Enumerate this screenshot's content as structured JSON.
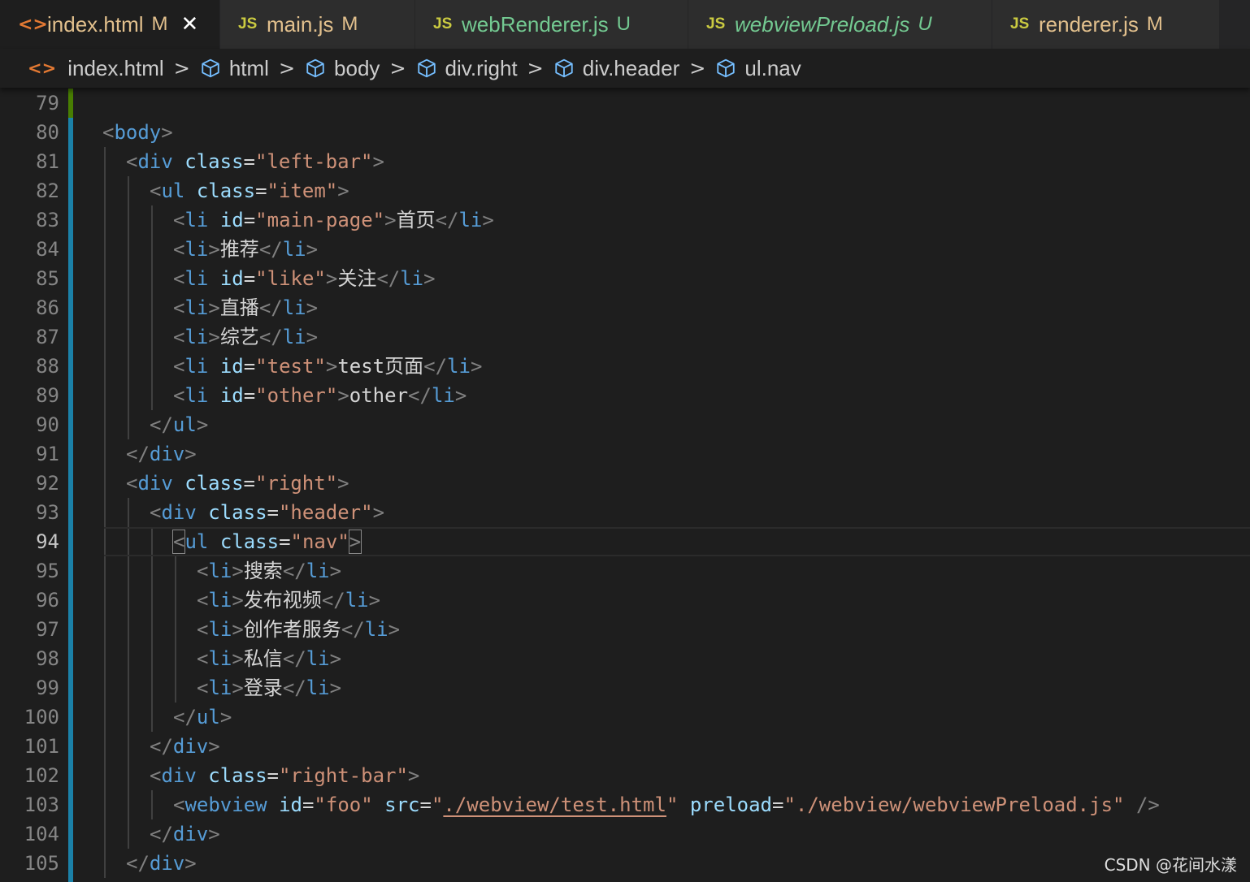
{
  "tabs": [
    {
      "icon": "html-icon",
      "glyph": "<>",
      "name": "index.html",
      "status": "M",
      "name_color": "#e2c08d",
      "status_color": "#e2c08d",
      "active": true,
      "close": "✕",
      "italic": false,
      "width": 271
    },
    {
      "icon": "js-icon",
      "glyph": "JS",
      "name": "main.js",
      "status": "M",
      "name_color": "#e2c08d",
      "status_color": "#e2c08d",
      "active": false,
      "italic": false,
      "width": 240
    },
    {
      "icon": "js-icon",
      "glyph": "JS",
      "name": "webRenderer.js",
      "status": "U",
      "name_color": "#73c991",
      "status_color": "#73c991",
      "active": false,
      "italic": false,
      "width": 336
    },
    {
      "icon": "js-icon",
      "glyph": "JS",
      "name": "webviewPreload.js",
      "status": "U",
      "name_color": "#73c991",
      "status_color": "#73c991",
      "active": false,
      "italic": true,
      "width": 374
    },
    {
      "icon": "js-icon",
      "glyph": "JS",
      "name": "renderer.js",
      "status": "M",
      "name_color": "#e2c08d",
      "status_color": "#e2c08d",
      "active": false,
      "italic": false,
      "width": 280
    }
  ],
  "breadcrumb": [
    {
      "icon": "html-icon",
      "label": "index.html"
    },
    {
      "icon": "cube-icon",
      "label": "html"
    },
    {
      "icon": "cube-icon",
      "label": "body"
    },
    {
      "icon": "cube-icon",
      "label": "div.right"
    },
    {
      "icon": "cube-icon",
      "label": "div.header"
    },
    {
      "icon": "cube-icon",
      "label": "ul.nav"
    }
  ],
  "separator": ">",
  "colors": {
    "background": "#1e1e1e",
    "tag": "#569cd6",
    "attribute": "#9cdcfe",
    "string": "#ce9178",
    "bracket": "#808080",
    "text": "#d4d4d4",
    "gutter_modified": "#1b81a8",
    "gutter_added": "#487e02"
  },
  "current_line": 94,
  "lines": [
    {
      "n": 79,
      "indent": 0,
      "tokens": []
    },
    {
      "n": 80,
      "indent": 0,
      "tokens": [
        [
          "b",
          "<"
        ],
        [
          "tag",
          "body"
        ],
        [
          "b",
          ">"
        ]
      ]
    },
    {
      "n": 81,
      "indent": 1,
      "tokens": [
        [
          "b",
          "<"
        ],
        [
          "tag",
          "div"
        ],
        [
          "txt",
          " "
        ],
        [
          "attr",
          "class"
        ],
        [
          "txt",
          "="
        ],
        [
          "str",
          "\"left-bar\""
        ],
        [
          "b",
          ">"
        ]
      ]
    },
    {
      "n": 82,
      "indent": 2,
      "tokens": [
        [
          "b",
          "<"
        ],
        [
          "tag",
          "ul"
        ],
        [
          "txt",
          " "
        ],
        [
          "attr",
          "class"
        ],
        [
          "txt",
          "="
        ],
        [
          "str",
          "\"item\""
        ],
        [
          "b",
          ">"
        ]
      ]
    },
    {
      "n": 83,
      "indent": 3,
      "tokens": [
        [
          "b",
          "<"
        ],
        [
          "tag",
          "li"
        ],
        [
          "txt",
          " "
        ],
        [
          "attr",
          "id"
        ],
        [
          "txt",
          "="
        ],
        [
          "str",
          "\"main-page\""
        ],
        [
          "b",
          ">"
        ],
        [
          "txt",
          "首页"
        ],
        [
          "b",
          "</"
        ],
        [
          "tag",
          "li"
        ],
        [
          "b",
          ">"
        ]
      ]
    },
    {
      "n": 84,
      "indent": 3,
      "tokens": [
        [
          "b",
          "<"
        ],
        [
          "tag",
          "li"
        ],
        [
          "b",
          ">"
        ],
        [
          "txt",
          "推荐"
        ],
        [
          "b",
          "</"
        ],
        [
          "tag",
          "li"
        ],
        [
          "b",
          ">"
        ]
      ]
    },
    {
      "n": 85,
      "indent": 3,
      "tokens": [
        [
          "b",
          "<"
        ],
        [
          "tag",
          "li"
        ],
        [
          "txt",
          " "
        ],
        [
          "attr",
          "id"
        ],
        [
          "txt",
          "="
        ],
        [
          "str",
          "\"like\""
        ],
        [
          "b",
          ">"
        ],
        [
          "txt",
          "关注"
        ],
        [
          "b",
          "</"
        ],
        [
          "tag",
          "li"
        ],
        [
          "b",
          ">"
        ]
      ]
    },
    {
      "n": 86,
      "indent": 3,
      "tokens": [
        [
          "b",
          "<"
        ],
        [
          "tag",
          "li"
        ],
        [
          "b",
          ">"
        ],
        [
          "txt",
          "直播"
        ],
        [
          "b",
          "</"
        ],
        [
          "tag",
          "li"
        ],
        [
          "b",
          ">"
        ]
      ]
    },
    {
      "n": 87,
      "indent": 3,
      "tokens": [
        [
          "b",
          "<"
        ],
        [
          "tag",
          "li"
        ],
        [
          "b",
          ">"
        ],
        [
          "txt",
          "综艺"
        ],
        [
          "b",
          "</"
        ],
        [
          "tag",
          "li"
        ],
        [
          "b",
          ">"
        ]
      ]
    },
    {
      "n": 88,
      "indent": 3,
      "tokens": [
        [
          "b",
          "<"
        ],
        [
          "tag",
          "li"
        ],
        [
          "txt",
          " "
        ],
        [
          "attr",
          "id"
        ],
        [
          "txt",
          "="
        ],
        [
          "str",
          "\"test\""
        ],
        [
          "b",
          ">"
        ],
        [
          "txt",
          "test页面"
        ],
        [
          "b",
          "</"
        ],
        [
          "tag",
          "li"
        ],
        [
          "b",
          ">"
        ]
      ]
    },
    {
      "n": 89,
      "indent": 3,
      "tokens": [
        [
          "b",
          "<"
        ],
        [
          "tag",
          "li"
        ],
        [
          "txt",
          " "
        ],
        [
          "attr",
          "id"
        ],
        [
          "txt",
          "="
        ],
        [
          "str",
          "\"other\""
        ],
        [
          "b",
          ">"
        ],
        [
          "txt",
          "other"
        ],
        [
          "b",
          "</"
        ],
        [
          "tag",
          "li"
        ],
        [
          "b",
          ">"
        ]
      ]
    },
    {
      "n": 90,
      "indent": 2,
      "tokens": [
        [
          "b",
          "</"
        ],
        [
          "tag",
          "ul"
        ],
        [
          "b",
          ">"
        ]
      ]
    },
    {
      "n": 91,
      "indent": 1,
      "tokens": [
        [
          "b",
          "</"
        ],
        [
          "tag",
          "div"
        ],
        [
          "b",
          ">"
        ]
      ]
    },
    {
      "n": 92,
      "indent": 1,
      "tokens": [
        [
          "b",
          "<"
        ],
        [
          "tag",
          "div"
        ],
        [
          "txt",
          " "
        ],
        [
          "attr",
          "class"
        ],
        [
          "txt",
          "="
        ],
        [
          "str",
          "\"right\""
        ],
        [
          "b",
          ">"
        ]
      ]
    },
    {
      "n": 93,
      "indent": 2,
      "tokens": [
        [
          "b",
          "<"
        ],
        [
          "tag",
          "div"
        ],
        [
          "txt",
          " "
        ],
        [
          "attr",
          "class"
        ],
        [
          "txt",
          "="
        ],
        [
          "str",
          "\"header\""
        ],
        [
          "b",
          ">"
        ]
      ]
    },
    {
      "n": 94,
      "indent": 3,
      "tokens": [
        [
          "bm",
          "<"
        ],
        [
          "tag",
          "ul"
        ],
        [
          "txt",
          " "
        ],
        [
          "attr",
          "class"
        ],
        [
          "txt",
          "="
        ],
        [
          "str",
          "\"nav\""
        ],
        [
          "bm",
          ">"
        ]
      ]
    },
    {
      "n": 95,
      "indent": 4,
      "tokens": [
        [
          "b",
          "<"
        ],
        [
          "tag",
          "li"
        ],
        [
          "b",
          ">"
        ],
        [
          "txt",
          "搜索"
        ],
        [
          "b",
          "</"
        ],
        [
          "tag",
          "li"
        ],
        [
          "b",
          ">"
        ]
      ]
    },
    {
      "n": 96,
      "indent": 4,
      "tokens": [
        [
          "b",
          "<"
        ],
        [
          "tag",
          "li"
        ],
        [
          "b",
          ">"
        ],
        [
          "txt",
          "发布视频"
        ],
        [
          "b",
          "</"
        ],
        [
          "tag",
          "li"
        ],
        [
          "b",
          ">"
        ]
      ]
    },
    {
      "n": 97,
      "indent": 4,
      "tokens": [
        [
          "b",
          "<"
        ],
        [
          "tag",
          "li"
        ],
        [
          "b",
          ">"
        ],
        [
          "txt",
          "创作者服务"
        ],
        [
          "b",
          "</"
        ],
        [
          "tag",
          "li"
        ],
        [
          "b",
          ">"
        ]
      ]
    },
    {
      "n": 98,
      "indent": 4,
      "tokens": [
        [
          "b",
          "<"
        ],
        [
          "tag",
          "li"
        ],
        [
          "b",
          ">"
        ],
        [
          "txt",
          "私信"
        ],
        [
          "b",
          "</"
        ],
        [
          "tag",
          "li"
        ],
        [
          "b",
          ">"
        ]
      ]
    },
    {
      "n": 99,
      "indent": 4,
      "tokens": [
        [
          "b",
          "<"
        ],
        [
          "tag",
          "li"
        ],
        [
          "b",
          ">"
        ],
        [
          "txt",
          "登录"
        ],
        [
          "b",
          "</"
        ],
        [
          "tag",
          "li"
        ],
        [
          "b",
          ">"
        ]
      ]
    },
    {
      "n": 100,
      "indent": 3,
      "tokens": [
        [
          "b",
          "</"
        ],
        [
          "tag",
          "ul"
        ],
        [
          "b",
          ">"
        ]
      ]
    },
    {
      "n": 101,
      "indent": 2,
      "tokens": [
        [
          "b",
          "</"
        ],
        [
          "tag",
          "div"
        ],
        [
          "b",
          ">"
        ]
      ]
    },
    {
      "n": 102,
      "indent": 2,
      "tokens": [
        [
          "b",
          "<"
        ],
        [
          "tag",
          "div"
        ],
        [
          "txt",
          " "
        ],
        [
          "attr",
          "class"
        ],
        [
          "txt",
          "="
        ],
        [
          "str",
          "\"right-bar\""
        ],
        [
          "b",
          ">"
        ]
      ]
    },
    {
      "n": 103,
      "indent": 3,
      "tokens": [
        [
          "b",
          "<"
        ],
        [
          "tag",
          "webview"
        ],
        [
          "txt",
          " "
        ],
        [
          "attr",
          "id"
        ],
        [
          "txt",
          "="
        ],
        [
          "str",
          "\"foo\""
        ],
        [
          "txt",
          " "
        ],
        [
          "attr",
          "src"
        ],
        [
          "txt",
          "="
        ],
        [
          "str",
          "\""
        ],
        [
          "link",
          "./webview/test.html"
        ],
        [
          "str",
          "\""
        ],
        [
          "txt",
          " "
        ],
        [
          "attr",
          "preload"
        ],
        [
          "txt",
          "="
        ],
        [
          "str",
          "\"./webview/webviewPreload.js\""
        ],
        [
          "txt",
          " "
        ],
        [
          "b",
          "/>"
        ]
      ]
    },
    {
      "n": 104,
      "indent": 2,
      "tokens": [
        [
          "b",
          "</"
        ],
        [
          "tag",
          "div"
        ],
        [
          "b",
          ">"
        ]
      ]
    },
    {
      "n": 105,
      "indent": 1,
      "tokens": [
        [
          "b",
          "</"
        ],
        [
          "tag",
          "div"
        ],
        [
          "b",
          ">"
        ]
      ]
    }
  ],
  "watermark": "CSDN @花间水漾"
}
